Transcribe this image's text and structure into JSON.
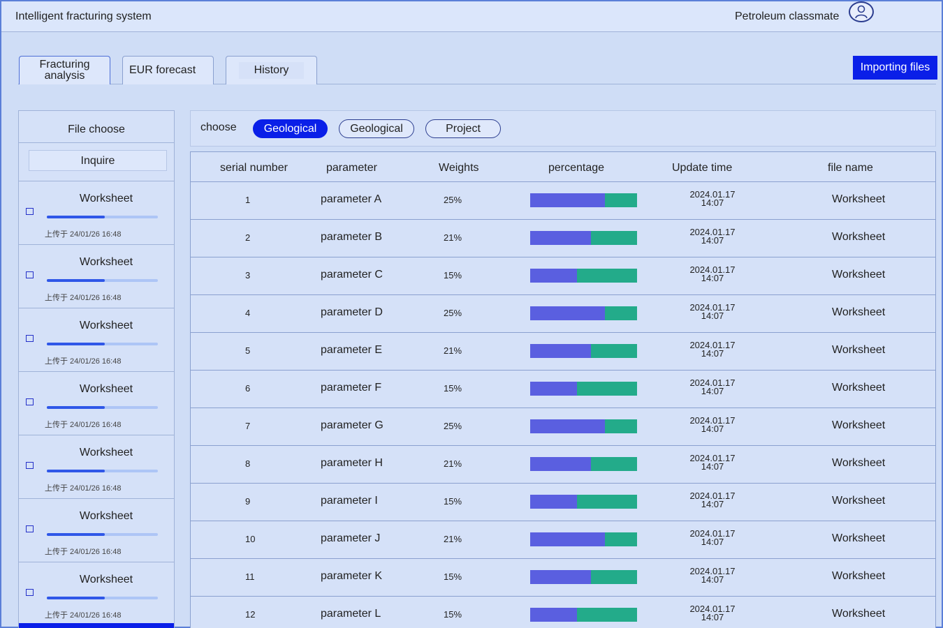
{
  "header": {
    "title": "Intelligent fracturing system",
    "username": "Petroleum classmate"
  },
  "tabs": [
    {
      "label": "Fracturing analysis"
    },
    {
      "label": "EUR forecast"
    },
    {
      "label": "History"
    }
  ],
  "import_button": "Importing files",
  "sidebar": {
    "title": "File choose",
    "inquire": "Inquire",
    "items": [
      {
        "name": "Worksheet",
        "meta": "上传于 24/01/26 16:48",
        "progress": 0.52
      },
      {
        "name": "Worksheet",
        "meta": "上传于 24/01/26 16:48",
        "progress": 0.52
      },
      {
        "name": "Worksheet",
        "meta": "上传于 24/01/26 16:48",
        "progress": 0.52
      },
      {
        "name": "Worksheet",
        "meta": "上传于 24/01/26 16:48",
        "progress": 0.52
      },
      {
        "name": "Worksheet",
        "meta": "上传于 24/01/26 16:48",
        "progress": 0.52
      },
      {
        "name": "Worksheet",
        "meta": "上传于 24/01/26 16:48",
        "progress": 0.52
      },
      {
        "name": "Worksheet",
        "meta": "上传于 24/01/26 16:48",
        "progress": 0.52
      }
    ]
  },
  "filter": {
    "label": "choose",
    "chips": [
      {
        "label": "Geological",
        "active": true
      },
      {
        "label": "Geological",
        "active": false
      },
      {
        "label": "Project",
        "active": false
      }
    ]
  },
  "table": {
    "columns": [
      "serial number",
      "parameter",
      "Weights",
      "percentage",
      "Update time",
      "file name"
    ],
    "rows": [
      {
        "num": "1",
        "param": "parameter A",
        "weight": "25%",
        "share": 0.7,
        "date": "2024.01.17",
        "time": "14:07",
        "file": "Worksheet"
      },
      {
        "num": "2",
        "param": "parameter B",
        "weight": "21%",
        "share": 0.57,
        "date": "2024.01.17",
        "time": "14:07",
        "file": "Worksheet"
      },
      {
        "num": "3",
        "param": "parameter C",
        "weight": "15%",
        "share": 0.44,
        "date": "2024.01.17",
        "time": "14:07",
        "file": "Worksheet"
      },
      {
        "num": "4",
        "param": "parameter D",
        "weight": "25%",
        "share": 0.7,
        "date": "2024.01.17",
        "time": "14:07",
        "file": "Worksheet"
      },
      {
        "num": "5",
        "param": "parameter E",
        "weight": "21%",
        "share": 0.57,
        "date": "2024.01.17",
        "time": "14:07",
        "file": "Worksheet"
      },
      {
        "num": "6",
        "param": "parameter F",
        "weight": "15%",
        "share": 0.44,
        "date": "2024.01.17",
        "time": "14:07",
        "file": "Worksheet"
      },
      {
        "num": "7",
        "param": "parameter G",
        "weight": "25%",
        "share": 0.7,
        "date": "2024.01.17",
        "time": "14:07",
        "file": "Worksheet"
      },
      {
        "num": "8",
        "param": "parameter H",
        "weight": "21%",
        "share": 0.57,
        "date": "2024.01.17",
        "time": "14:07",
        "file": "Worksheet"
      },
      {
        "num": "9",
        "param": "parameter I",
        "weight": "15%",
        "share": 0.44,
        "date": "2024.01.17",
        "time": "14:07",
        "file": "Worksheet"
      },
      {
        "num": "10",
        "param": "parameter J",
        "weight": "21%",
        "share": 0.7,
        "date": "2024.01.17",
        "time": "14:07",
        "file": "Worksheet"
      },
      {
        "num": "11",
        "param": "parameter K",
        "weight": "15%",
        "share": 0.57,
        "date": "2024.01.17",
        "time": "14:07",
        "file": "Worksheet"
      },
      {
        "num": "12",
        "param": "parameter L",
        "weight": "15%",
        "share": 0.44,
        "date": "2024.01.17",
        "time": "14:07",
        "file": "Worksheet"
      }
    ]
  }
}
